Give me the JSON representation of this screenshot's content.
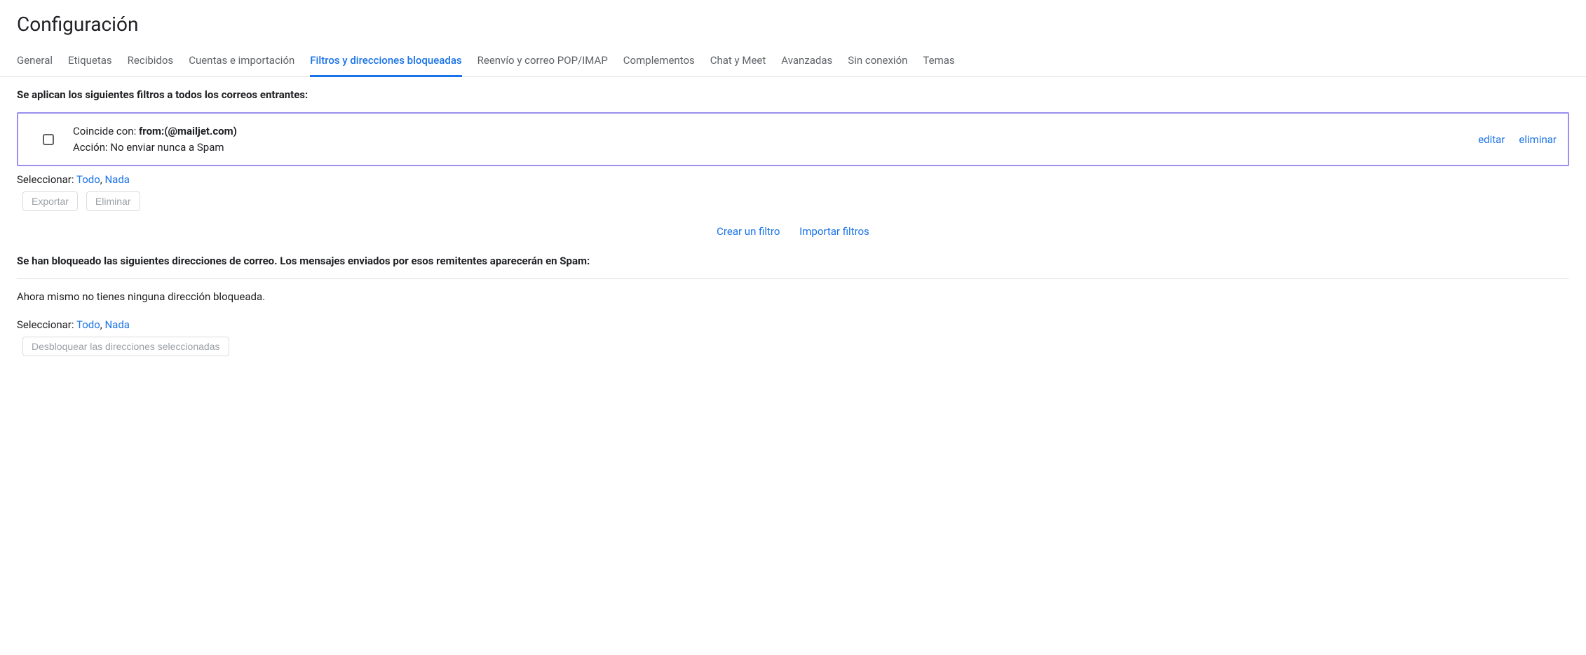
{
  "page_title": "Configuración",
  "tabs": [
    {
      "label": "General",
      "active": false
    },
    {
      "label": "Etiquetas",
      "active": false
    },
    {
      "label": "Recibidos",
      "active": false
    },
    {
      "label": "Cuentas e importación",
      "active": false
    },
    {
      "label": "Filtros y direcciones bloqueadas",
      "active": true
    },
    {
      "label": "Reenvío y correo POP/IMAP",
      "active": false
    },
    {
      "label": "Complementos",
      "active": false
    },
    {
      "label": "Chat y Meet",
      "active": false
    },
    {
      "label": "Avanzadas",
      "active": false
    },
    {
      "label": "Sin conexión",
      "active": false
    },
    {
      "label": "Temas",
      "active": false
    }
  ],
  "filters": {
    "heading": "Se aplican los siguientes filtros a todos los correos entrantes:",
    "row": {
      "match_label": "Coincide con: ",
      "match_value": "from:(@mailjet.com)",
      "action_label": "Acción: ",
      "action_value": "No enviar nunca a Spam",
      "edit": "editar",
      "delete": "eliminar"
    },
    "select_label": "Seleccionar: ",
    "select_all": "Todo",
    "select_sep": ", ",
    "select_none": "Nada",
    "export_btn": "Exportar",
    "delete_btn": "Eliminar",
    "create_link": "Crear un filtro",
    "import_link": "Importar filtros"
  },
  "blocked": {
    "heading": "Se han bloqueado las siguientes direcciones de correo. Los mensajes enviados por esos remitentes aparecerán en Spam:",
    "empty_text": "Ahora mismo no tienes ninguna dirección bloqueada.",
    "select_label": "Seleccionar: ",
    "select_all": "Todo",
    "select_sep": ", ",
    "select_none": "Nada",
    "unblock_btn": "Desbloquear las direcciones seleccionadas"
  }
}
